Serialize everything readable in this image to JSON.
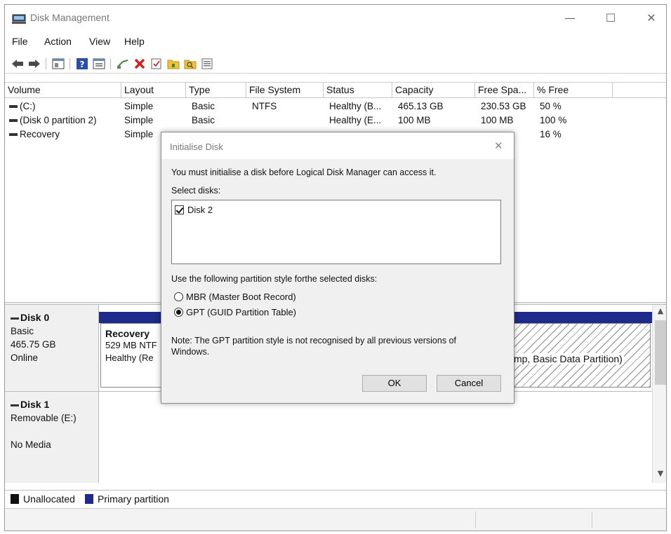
{
  "window": {
    "title": "Disk Management",
    "minimize_glyph": "—",
    "maximize_glyph": "☐",
    "close_glyph": "✕"
  },
  "menu": [
    "File",
    "Action",
    "View",
    "Help"
  ],
  "toolbar_icons": [
    "back-arrow-icon",
    "forward-arrow-icon",
    "console-tree-icon",
    "help-icon",
    "properties-icon",
    "connect-icon",
    "delete-icon",
    "check-icon",
    "folder-icon",
    "folder-search-icon",
    "list-icon"
  ],
  "volume_list": {
    "columns": [
      "Volume",
      "Layout",
      "Type",
      "File System",
      "Status",
      "Capacity",
      "Free Spa...",
      "% Free"
    ],
    "rows": [
      [
        "(C:)",
        "Simple",
        "Basic",
        "NTFS",
        "Healthy (B...",
        "465.13 GB",
        "230.53 GB",
        "50 %"
      ],
      [
        "(Disk 0 partition 2)",
        "Simple",
        "Basic",
        "",
        "Healthy (E...",
        "100 MB",
        "100 MB",
        "100 %"
      ],
      [
        "Recovery",
        "Simple",
        "",
        "",
        "",
        "",
        "",
        "16 %"
      ]
    ]
  },
  "disks": [
    {
      "name": "Disk 0",
      "lines": [
        "Basic",
        "465.75 GB",
        "Online"
      ],
      "recovery": {
        "title": "Recovery",
        "size": "529 MB NTF",
        "status": "Healthy (Re"
      },
      "data_partition_label": "mp, Basic Data Partition)"
    },
    {
      "name": "Disk 1",
      "lines": [
        "Removable (E:)",
        "",
        "No Media"
      ]
    }
  ],
  "legend": [
    {
      "label": "Unallocated",
      "color": "#111111"
    },
    {
      "label": "Primary partition",
      "color": "#1e2a8c"
    }
  ],
  "dialog": {
    "title": "Initialise Disk",
    "close_glyph": "✕",
    "intro": "You must initialise a disk before Logical Disk Manager can access it.",
    "select_label": "Select disks:",
    "disk_item": "Disk 2",
    "style_label": "Use the following partition style forthe selected disks:",
    "options": [
      "MBR (Master Boot Record)",
      "GPT (GUID Partition Table)"
    ],
    "selected_option": 1,
    "note_line1": "Note: The GPT partition style is not recognised by all previous versions of",
    "note_line2": "Windows.",
    "ok_label": "OK",
    "cancel_label": "Cancel"
  }
}
